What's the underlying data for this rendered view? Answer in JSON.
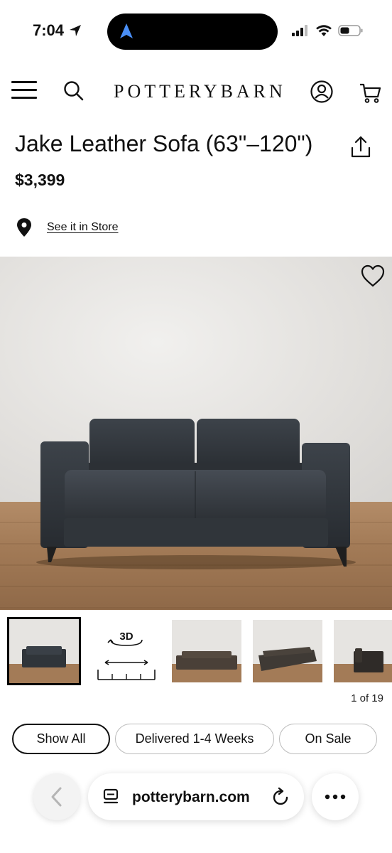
{
  "status_bar": {
    "time": "7:04"
  },
  "header": {
    "logo": "POTTERYBARN"
  },
  "product": {
    "title": "Jake Leather Sofa (63\"–120\")",
    "price": "$3,399",
    "store_link": "See it in Store"
  },
  "gallery": {
    "three_d_label": "3D",
    "counter": "1 of 19",
    "selected_index": 1,
    "total": 19
  },
  "filters": {
    "chips": [
      {
        "label": "Show All",
        "active": true
      },
      {
        "label": "Delivered 1-4 Weeks",
        "active": false
      },
      {
        "label": "On Sale",
        "active": false
      }
    ]
  },
  "browser": {
    "url": "potterybarn.com"
  },
  "colors": {
    "sofa": "#2f343a",
    "floor": "#a37b57",
    "wall": "#e4e2df",
    "island_arrow": "#4a8ff7"
  },
  "icons": {
    "menu": "hamburger-icon",
    "search": "search-icon",
    "account": "account-icon",
    "cart": "cart-icon",
    "share": "share-icon",
    "location": "location-pin-icon",
    "favorite": "heart-icon",
    "back": "chevron-left-icon",
    "tabs": "tabs-icon",
    "reload": "reload-icon",
    "more": "more-icon"
  }
}
